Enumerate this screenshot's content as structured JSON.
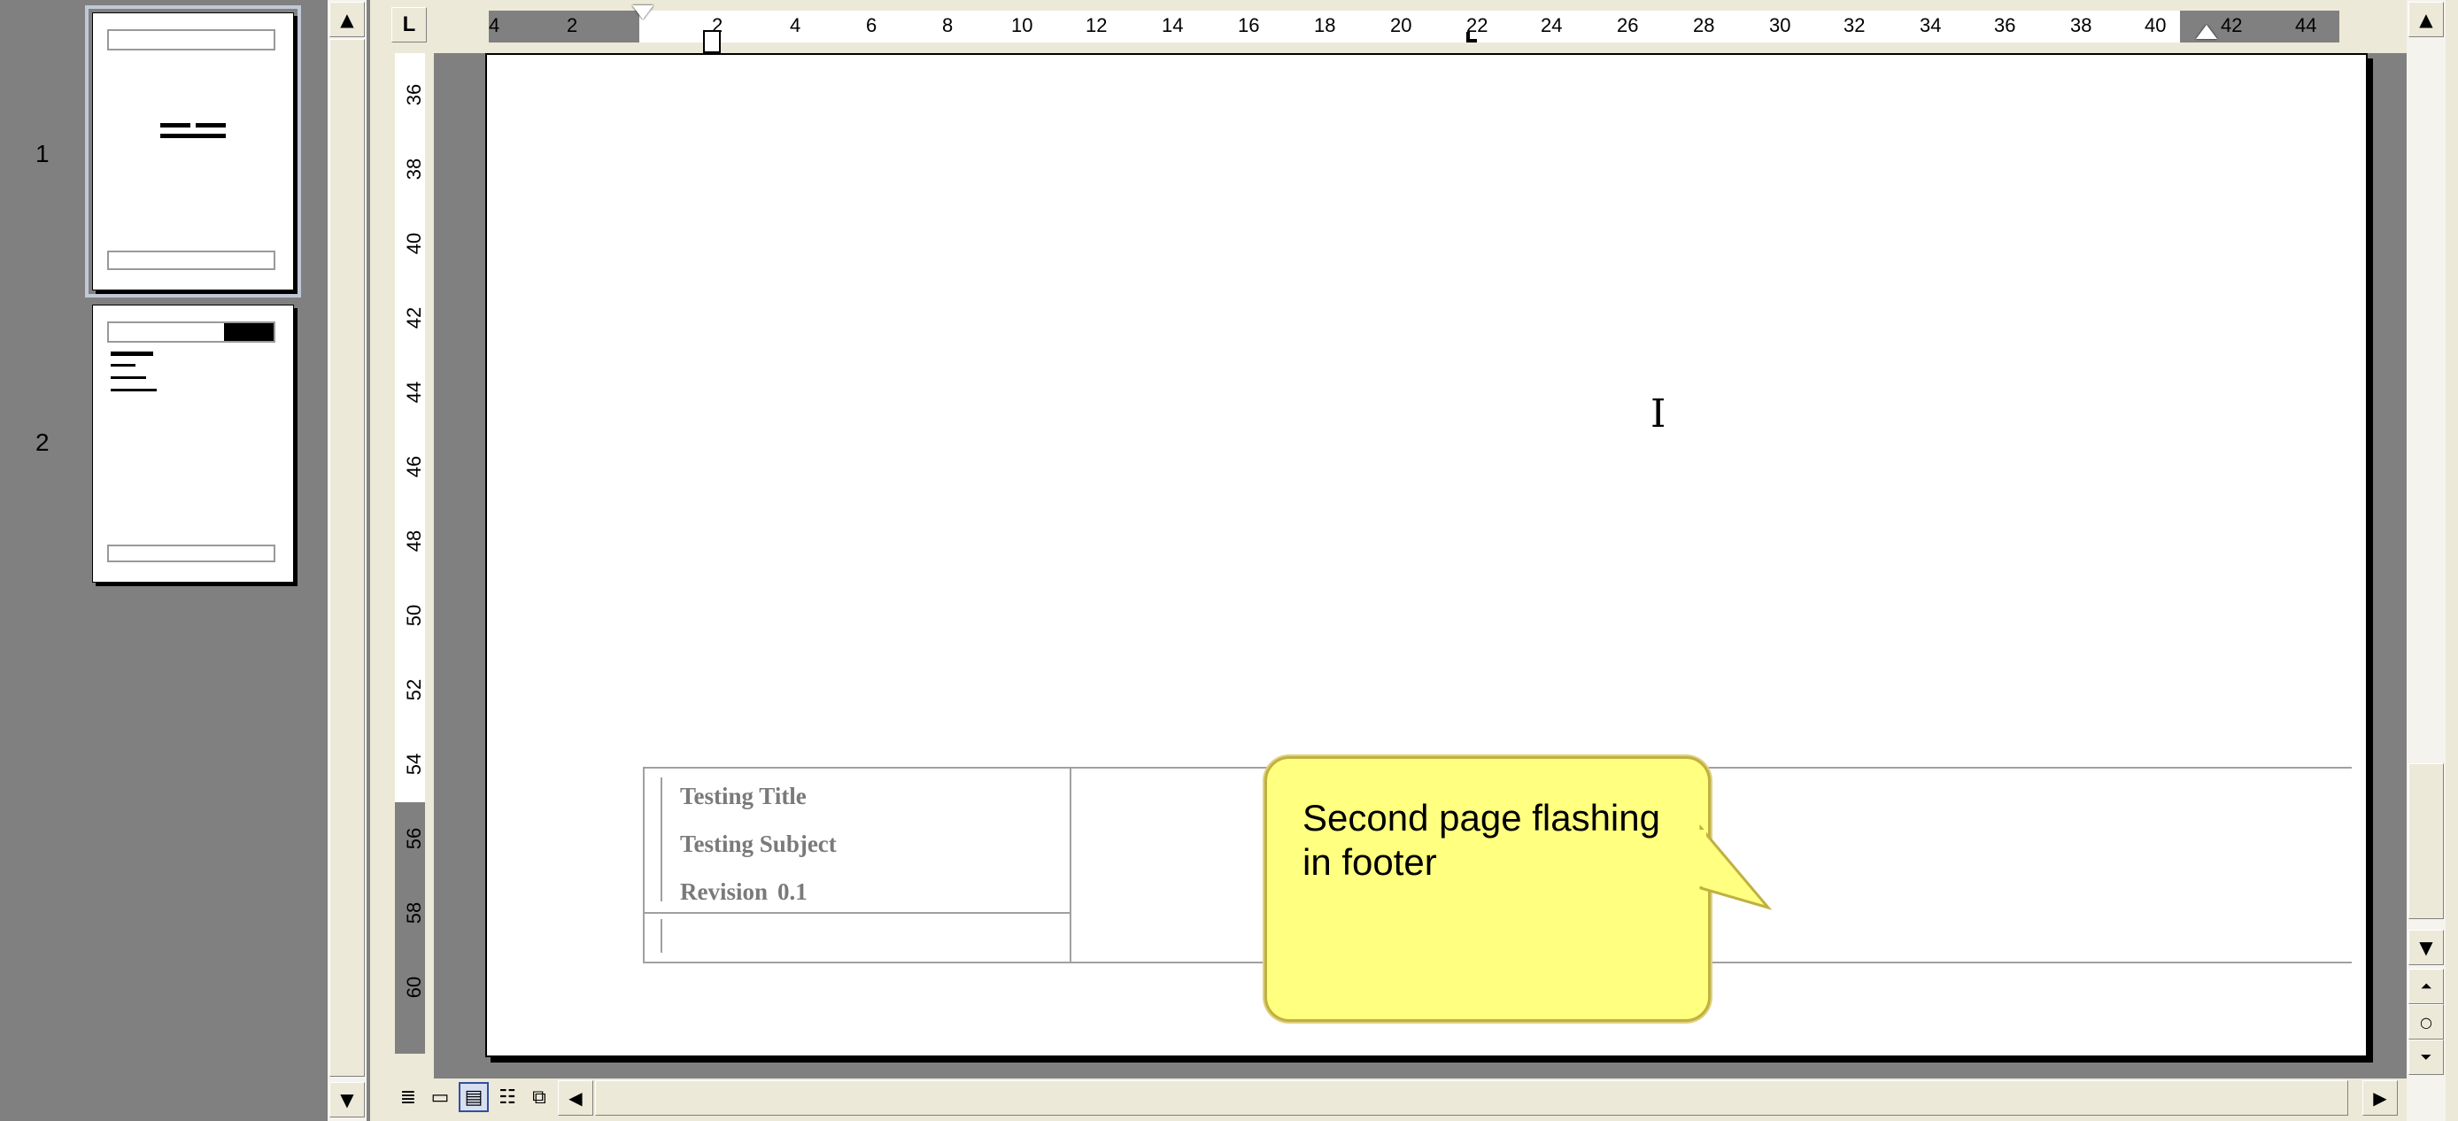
{
  "thumbnails": {
    "pages": [
      {
        "number": "1"
      },
      {
        "number": "2"
      }
    ]
  },
  "ruler": {
    "tab_selector": "L",
    "h_ticks": [
      "4",
      "2",
      "2",
      "4",
      "6",
      "8",
      "10",
      "12",
      "14",
      "16",
      "18",
      "20",
      "22",
      "24",
      "26",
      "28",
      "30",
      "32",
      "34",
      "36",
      "38",
      "40",
      "42",
      "44"
    ],
    "v_ticks": [
      "36",
      "38",
      "40",
      "42",
      "44",
      "46",
      "48",
      "50",
      "52",
      "54",
      "56",
      "58",
      "60"
    ]
  },
  "footer": {
    "title": "Testing Title",
    "subject": "Testing Subject",
    "revision_label": "Revision",
    "revision_value": "0.1"
  },
  "callout": {
    "text": "Second page flashing in footer"
  },
  "icons": {
    "scroll_up": "arrow-up-icon",
    "scroll_down": "arrow-down-icon",
    "scroll_left": "arrow-left-icon",
    "scroll_right": "arrow-right-icon",
    "prev_page": "previous-page-icon",
    "browse_object": "select-browse-object-icon",
    "next_page": "next-page-icon",
    "text_cursor": "i-beam-cursor-icon"
  },
  "view_buttons": [
    "normal-view",
    "web-layout-view",
    "print-layout-view",
    "outline-view",
    "reading-layout-view"
  ]
}
